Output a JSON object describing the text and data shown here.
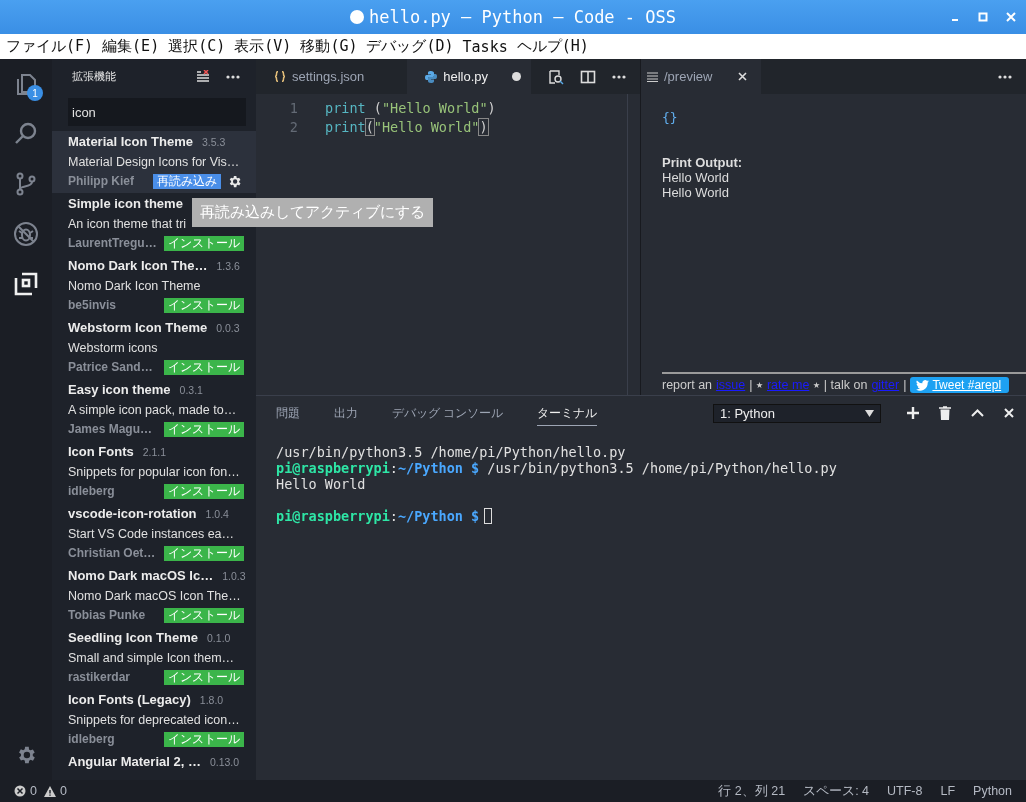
{
  "window": {
    "title": "hello.py — Python — Code - OSS",
    "modified": true
  },
  "menu": [
    "ファイル(F)",
    "編集(E)",
    "選択(C)",
    "表示(V)",
    "移動(G)",
    "デバッグ(D)",
    "Tasks",
    "ヘルプ(H)"
  ],
  "activity_bar": [
    {
      "kind": "explorer",
      "selected": false,
      "badge": "1"
    },
    {
      "kind": "search",
      "selected": false
    },
    {
      "kind": "scm",
      "selected": false
    },
    {
      "kind": "debug",
      "selected": false
    },
    {
      "kind": "extensions",
      "selected": true
    }
  ],
  "sidebar": {
    "title": "拡張機能",
    "search": {
      "value": "icon"
    },
    "tooltip": "再読み込みしてアクティブにする",
    "extensions": [
      {
        "name": "Material Icon Theme",
        "version": "3.5.3",
        "description": "Material Design Icons for Vis…",
        "author": "Philipp Kief",
        "action": {
          "kind": "reload",
          "label": "再読み込み"
        },
        "selected": true
      },
      {
        "name": "Simple icon theme",
        "description": "An icon theme that tri",
        "author": "LaurentTregu…",
        "action": {
          "kind": "install",
          "label": "インストール"
        },
        "selected": false
      },
      {
        "name": "Nomo Dark Icon The…",
        "version": "1.3.6",
        "description": "Nomo Dark Icon Theme",
        "author": "be5invis",
        "action": {
          "kind": "install",
          "label": "インストール"
        },
        "selected": false
      },
      {
        "name": "Webstorm Icon Theme",
        "version": "0.0.3",
        "description": "Webstorm icons",
        "author": "Patrice Sand…",
        "action": {
          "kind": "install",
          "label": "インストール"
        },
        "selected": false
      },
      {
        "name": "Easy icon theme",
        "version": "0.3.1",
        "description": "A simple icon pack, made to…",
        "author": "James Magu…",
        "action": {
          "kind": "install",
          "label": "インストール"
        },
        "selected": false
      },
      {
        "name": "Icon Fonts",
        "version": "2.1.1",
        "description": "Snippets for popular icon fon…",
        "author": "idleberg",
        "action": {
          "kind": "install",
          "label": "インストール"
        },
        "selected": false
      },
      {
        "name": "vscode-icon-rotation",
        "version": "1.0.4",
        "description": "Start VS Code instances ea…",
        "author": "Christian Oet…",
        "action": {
          "kind": "install",
          "label": "インストール"
        },
        "selected": false
      },
      {
        "name": "Nomo Dark macOS Ic…",
        "version": "1.0.3",
        "description": "Nomo Dark macOS Icon The…",
        "author": "Tobias Punke",
        "action": {
          "kind": "install",
          "label": "インストール"
        },
        "selected": false
      },
      {
        "name": "Seedling Icon Theme",
        "version": "0.1.0",
        "description": "Small and simple Icon them…",
        "author": "rastikerdar",
        "action": {
          "kind": "install",
          "label": "インストール"
        },
        "selected": false
      },
      {
        "name": "Icon Fonts (Legacy)",
        "version": "1.8.0",
        "description": "Snippets for deprecated icon…",
        "author": "idleberg",
        "action": {
          "kind": "install",
          "label": "インストール"
        },
        "selected": false
      },
      {
        "name": "Angular Material 2, …",
        "version": "0.13.0",
        "selected": false
      }
    ]
  },
  "editor": {
    "tabs": [
      {
        "label": "settings.json",
        "kind": "json",
        "selected": false,
        "dirty": false
      },
      {
        "label": "hello.py",
        "kind": "python",
        "selected": true,
        "dirty": true
      }
    ],
    "lines": [
      {
        "number": "1",
        "tokens": [
          {
            "kind": "fn",
            "text": "print"
          },
          {
            "kind": "plain",
            "text": " ("
          },
          {
            "kind": "string",
            "text": "\"Hello World\""
          },
          {
            "kind": "plain",
            "text": ")"
          }
        ]
      },
      {
        "number": "2",
        "tokens": [
          {
            "kind": "fn",
            "text": "print"
          },
          {
            "kind": "bracket",
            "text": "("
          },
          {
            "kind": "string",
            "text": "\"Hello World\""
          },
          {
            "kind": "bracket",
            "text": ")"
          }
        ]
      }
    ]
  },
  "preview": {
    "tab": "/preview",
    "json": "{}",
    "output_title": "Print Output:",
    "output_lines": [
      "Hello World",
      "Hello World"
    ],
    "footer": [
      {
        "kind": "text",
        "text": "report an"
      },
      {
        "kind": "link",
        "text": "issue"
      },
      {
        "kind": "text",
        "text": "| ⭑"
      },
      {
        "kind": "link",
        "text": "rate me"
      },
      {
        "kind": "text",
        "text": "⭑ | talk on"
      },
      {
        "kind": "link",
        "text": "gitter"
      },
      {
        "kind": "text",
        "text": "|"
      },
      {
        "kind": "button",
        "text": "Tweet #arepl"
      }
    ]
  },
  "panel": {
    "tabs": [
      {
        "label": "問題",
        "selected": false
      },
      {
        "label": "出力",
        "selected": false
      },
      {
        "label": "デバッグ コンソール",
        "selected": false
      },
      {
        "label": "ターミナル",
        "selected": true
      }
    ],
    "terminal_select": "1: Python",
    "terminal": [
      {
        "kind": "text",
        "segments": [
          {
            "kind": "plain",
            "text": "/usr/bin/python3.5 /home/pi/Python/hello.py"
          }
        ]
      },
      {
        "kind": "text",
        "segments": [
          {
            "kind": "user",
            "text": "pi@raspberrypi"
          },
          {
            "kind": "plain",
            "text": ":"
          },
          {
            "kind": "path",
            "text": "~/Python $"
          },
          {
            "kind": "plain",
            "text": " /usr/bin/python3.5 /home/pi/Python/hello.py"
          }
        ]
      },
      {
        "kind": "text",
        "segments": [
          {
            "kind": "plain",
            "text": "Hello World"
          }
        ]
      },
      {
        "kind": "blank"
      },
      {
        "kind": "text",
        "cursor": true,
        "segments": [
          {
            "kind": "user",
            "text": "pi@raspberrypi"
          },
          {
            "kind": "plain",
            "text": ":"
          },
          {
            "kind": "path",
            "text": "~/Python $"
          }
        ]
      }
    ]
  },
  "status_bar": {
    "errors": "0",
    "warnings": "0",
    "items": [
      "行 2、列 21",
      "スペース: 4",
      "UTF-8",
      "LF",
      "Python"
    ]
  }
}
